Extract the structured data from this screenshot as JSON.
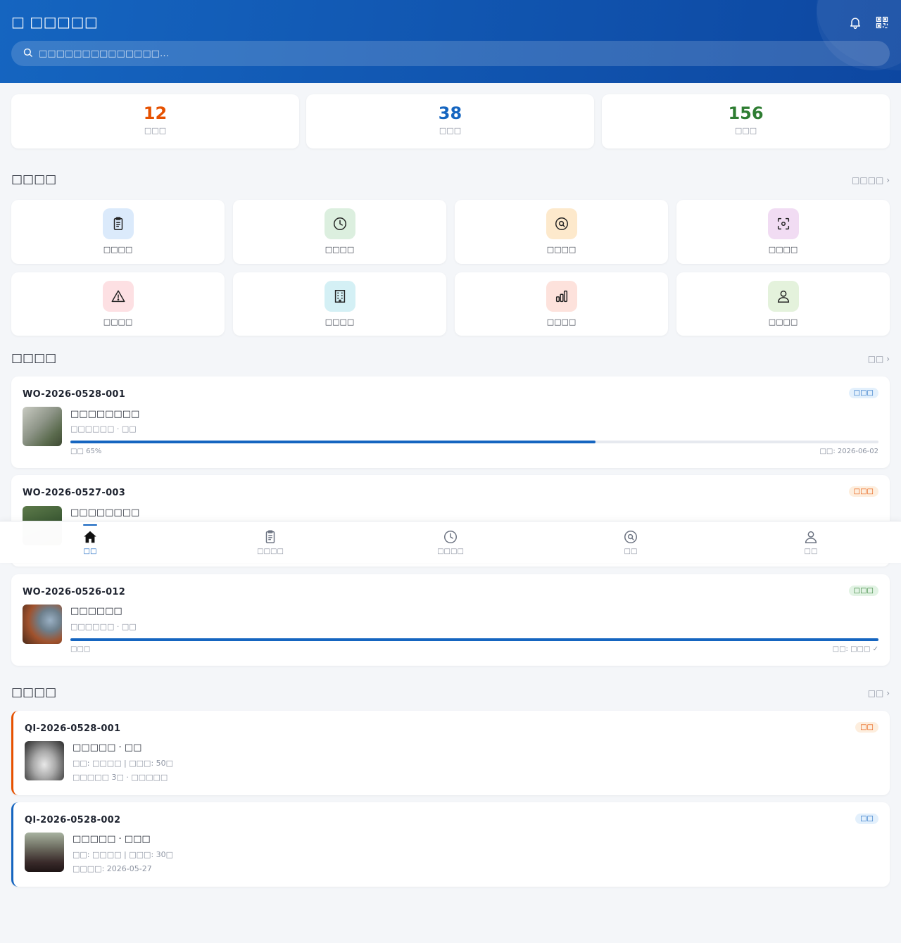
{
  "header": {
    "title": "□ □□□□□",
    "search_placeholder": "□□□□□□□□□□□□□□…",
    "icons": [
      "bell-icon",
      "qr-code-icon"
    ]
  },
  "stats": [
    {
      "value": "12",
      "label": "□□□",
      "color": "#e65100"
    },
    {
      "value": "38",
      "label": "□□□",
      "color": "#1565c0"
    },
    {
      "value": "156",
      "label": "□□□",
      "color": "#2e7d32"
    }
  ],
  "quick": {
    "title": "□□□□",
    "more": "□□□□ ›",
    "tiles": [
      {
        "label": "□□□□",
        "icon": "clipboard-icon",
        "bg": "#dbeafb"
      },
      {
        "label": "□□□□",
        "icon": "clock-icon",
        "bg": "#dcefdf"
      },
      {
        "label": "□□□□",
        "icon": "search-circle-icon",
        "bg": "#fde9cc"
      },
      {
        "label": "□□□□",
        "icon": "scan-icon",
        "bg": "#f1dcf3"
      },
      {
        "label": "□□□□",
        "icon": "warning-icon",
        "bg": "#fde0e3"
      },
      {
        "label": "□□□□",
        "icon": "building-icon",
        "bg": "#d4f0f5"
      },
      {
        "label": "□□□□",
        "icon": "bar-chart-icon",
        "bg": "#fde2dc"
      },
      {
        "label": "□□□□",
        "icon": "user-icon",
        "bg": "#e4f2dc"
      }
    ]
  },
  "workorders": {
    "title": "□□□□",
    "more": "□□ ›",
    "items": [
      {
        "code": "WO-2026-0528-001",
        "badge": "□□□",
        "badge_color": "#1565c0",
        "badge_bg": "#e3f0fc",
        "name": "□□□□□□□□",
        "sub": "□□□□□□ · □□",
        "progress": 0.65,
        "left": "□□ 65%",
        "right": "□□: 2026-06-02"
      },
      {
        "code": "WO-2026-0527-003",
        "badge": "□□□",
        "badge_color": "#e65100",
        "badge_bg": "#fdeede",
        "name": "□□□□□□□□",
        "sub": "",
        "progress": 0,
        "left": "",
        "right": ""
      },
      {
        "code": "WO-2026-0526-012",
        "badge": "□□□",
        "badge_color": "#2e7d32",
        "badge_bg": "#e2f3e4",
        "name": "□□□□□□",
        "sub": "□□□□□□ · □□",
        "progress": 1.0,
        "left": "□□□",
        "right": "□□: □□□ ✓"
      }
    ]
  },
  "quality": {
    "title": "□□□□",
    "more": "□□ ›",
    "items": [
      {
        "code": "QI-2026-0528-001",
        "badge": "□□",
        "badge_color": "#e65100",
        "badge_bg": "#fdeede",
        "accent": "#e65100",
        "name": "□□□□□ · □□",
        "sub1": "□□: □□□□ | □□□: 50□",
        "sub2": "□□□□□ 3□ · □□□□□"
      },
      {
        "code": "QI-2026-0528-002",
        "badge": "□□",
        "badge_color": "#1565c0",
        "badge_bg": "#e3f0fc",
        "accent": "#1565c0",
        "name": "□□□□□ · □□□",
        "sub1": "□□: □□□□ | □□□: 30□",
        "sub2": "□□□□: 2026-05-27"
      }
    ]
  },
  "tabbar": [
    {
      "label": "□□",
      "icon": "home-icon",
      "active": true
    },
    {
      "label": "□□□□",
      "icon": "clipboard-icon",
      "active": false
    },
    {
      "label": "□□□□",
      "icon": "clock-icon",
      "active": false
    },
    {
      "label": "□□",
      "icon": "search-circle-icon",
      "active": false
    },
    {
      "label": "□□",
      "icon": "user-icon",
      "active": false
    }
  ]
}
